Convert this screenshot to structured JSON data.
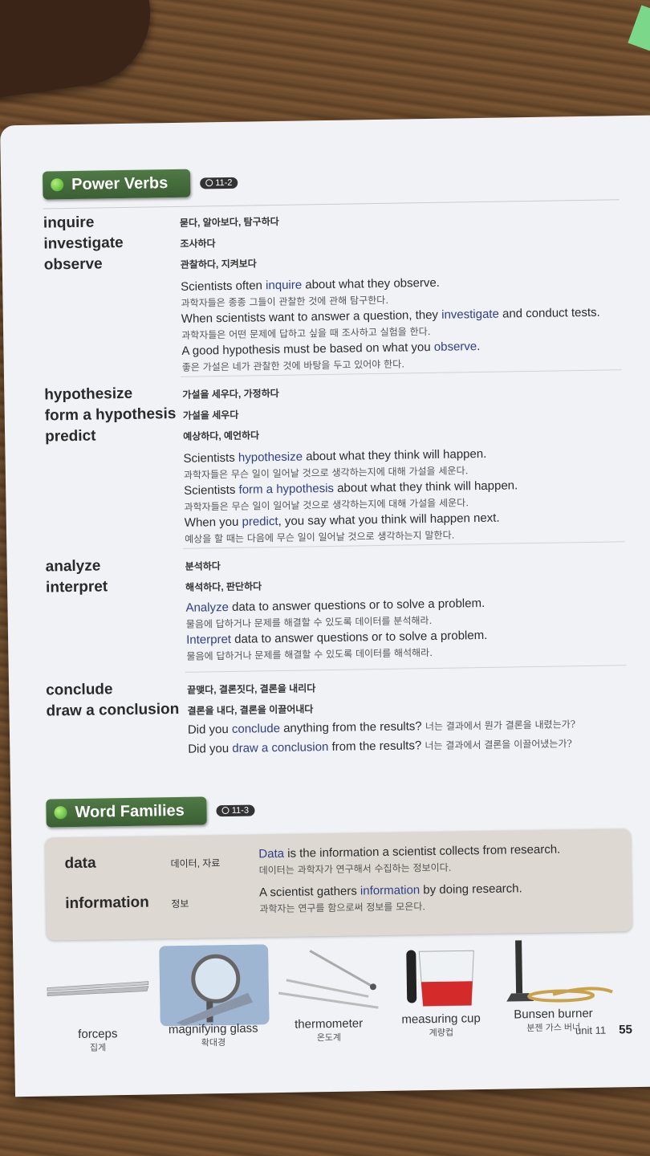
{
  "power_verbs": {
    "title": "Power Verbs",
    "track": "11-2",
    "groups": [
      {
        "terms": [
          "inquire",
          "investigate",
          "observe"
        ],
        "defs": [
          "묻다, 알아보다, 탐구하다",
          "조사하다",
          "관찰하다, 지켜보다"
        ],
        "examples": [
          {
            "pre": "Scientists often ",
            "kw": "inquire",
            "post": " about what they observe.",
            "ko": "과학자들은 종종 그들이 관찰한 것에 관해 탐구한다."
          },
          {
            "pre": "When scientists want to answer a question, they ",
            "kw": "investigate",
            "post": " and conduct tests.",
            "ko": "과학자들은 어떤 문제에 답하고 싶을 때 조사하고 실험을 한다."
          },
          {
            "pre": "A good hypothesis must be based on what you ",
            "kw": "observe",
            "post": ".",
            "ko": "좋은 가설은 네가 관찰한 것에 바탕을 두고 있어야 한다."
          }
        ]
      },
      {
        "terms": [
          "hypothesize",
          "form a hypothesis",
          "predict"
        ],
        "defs": [
          "가설을 세우다, 가정하다",
          "가설을 세우다",
          "예상하다, 예언하다"
        ],
        "examples": [
          {
            "pre": "Scientists ",
            "kw": "hypothesize",
            "post": " about what they think will happen.",
            "ko": "과학자들은 무슨 일이 일어날 것으로 생각하는지에 대해 가설을 세운다."
          },
          {
            "pre": "Scientists ",
            "kw": "form a hypothesis",
            "post": " about what they think will happen.",
            "ko": "과학자들은 무슨 일이 일어날 것으로 생각하는지에 대해 가설을 세운다."
          },
          {
            "pre": "When you ",
            "kw": "predict",
            "post": ", you say what you think will happen next.",
            "ko": "예상을 할 때는 다음에 무슨 일이 일어날 것으로 생각하는지 말한다."
          }
        ]
      },
      {
        "terms": [
          "analyze",
          "interpret"
        ],
        "defs": [
          "분석하다",
          "해석하다, 판단하다"
        ],
        "examples": [
          {
            "pre": "",
            "kw": "Analyze",
            "post": " data to answer questions or to solve a problem.",
            "ko": "물음에 답하거나 문제를 해결할 수 있도록 데이터를 분석해라."
          },
          {
            "pre": "",
            "kw": "Interpret",
            "post": " data to answer questions or to solve a problem.",
            "ko": "물음에 답하거나 문제를 해결할 수 있도록 데이터를 해석해라."
          }
        ]
      },
      {
        "terms": [
          "conclude",
          "draw a conclusion"
        ],
        "defs": [
          "끝맺다, 결론짓다, 결론을 내리다",
          "결론을 내다, 결론을 이끌어내다"
        ],
        "examples": [
          {
            "pre": "Did you ",
            "kw": "conclude",
            "post": " anything from the results?",
            "ko": "너는 결과에서 뭔가 결론을 내렸는가?"
          },
          {
            "pre": "Did you ",
            "kw": "draw a conclusion",
            "post": " from the results?",
            "ko": "너는 결과에서 결론을 이끌어냈는가?"
          }
        ]
      }
    ]
  },
  "word_families": {
    "title": "Word Families",
    "track": "11-3",
    "rows": [
      {
        "term": "data",
        "ko": "데이터, 자료",
        "pre": "",
        "kw": "Data",
        "post": " is the information a scientist collects from research.",
        "ko_sentence": "데이터는 과학자가 연구해서 수집하는 정보이다."
      },
      {
        "term": "information",
        "ko": "정보",
        "pre": "A scientist gathers ",
        "kw": "information",
        "post": " by doing research.",
        "ko_sentence": "과학자는 연구를 함으로써 정보를 모은다."
      }
    ]
  },
  "tools": [
    {
      "en": "forceps",
      "ko": "집게"
    },
    {
      "en": "magnifying glass",
      "ko": "확대경"
    },
    {
      "en": "thermometer",
      "ko": "온도계"
    },
    {
      "en": "measuring cup",
      "ko": "계량컵"
    },
    {
      "en": "Bunsen burner",
      "ko": "분젠 가스 버너"
    }
  ],
  "footer": {
    "unit": "unit 11",
    "page": "55"
  },
  "colors": {
    "keyword": "#2f3f86",
    "section_green": "#3b5f34",
    "page": "#f1f2f5"
  }
}
